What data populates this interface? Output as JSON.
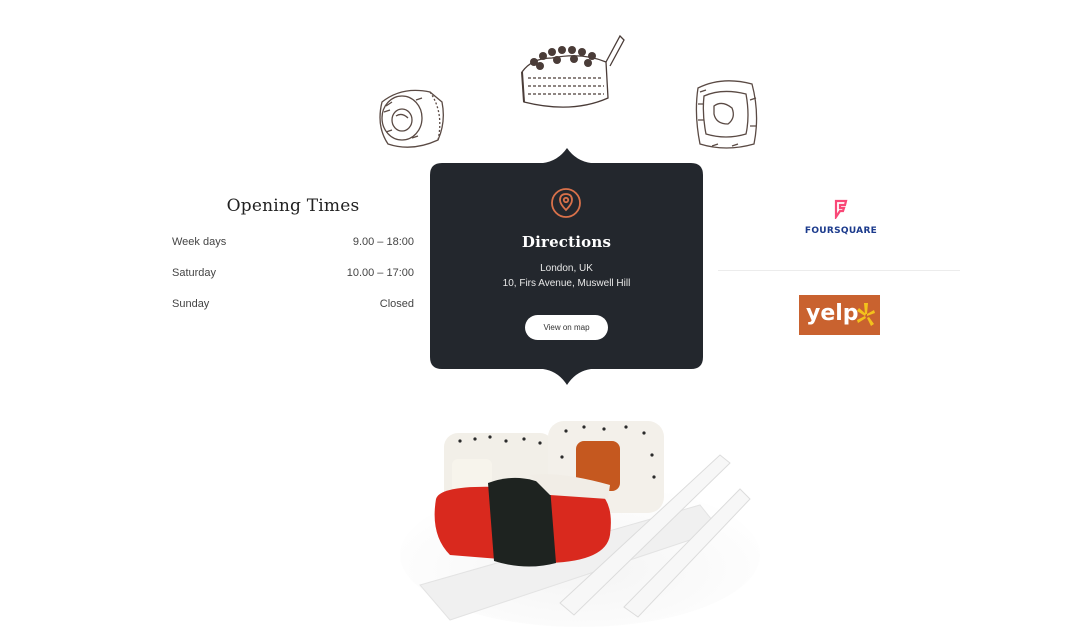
{
  "opening_times": {
    "title": "Opening Times",
    "rows": [
      {
        "day": "Week days",
        "hours": "9.00 – 18:00"
      },
      {
        "day": "Saturday",
        "hours": "10.00 – 17:00"
      },
      {
        "day": "Sunday",
        "hours": "Closed"
      }
    ]
  },
  "directions": {
    "title": "Directions",
    "address_line1": "London, UK",
    "address_line2": "10, Firs Avenue, Muswell Hill",
    "button_label": "View on map",
    "card_color": "#23272d",
    "icon_color": "#d9714a"
  },
  "reviews": {
    "foursquare_label": "FOURSQUARE",
    "yelp_label": "yelp"
  },
  "icons": [
    "location-pin-icon",
    "foursquare-logo",
    "yelp-logo"
  ]
}
